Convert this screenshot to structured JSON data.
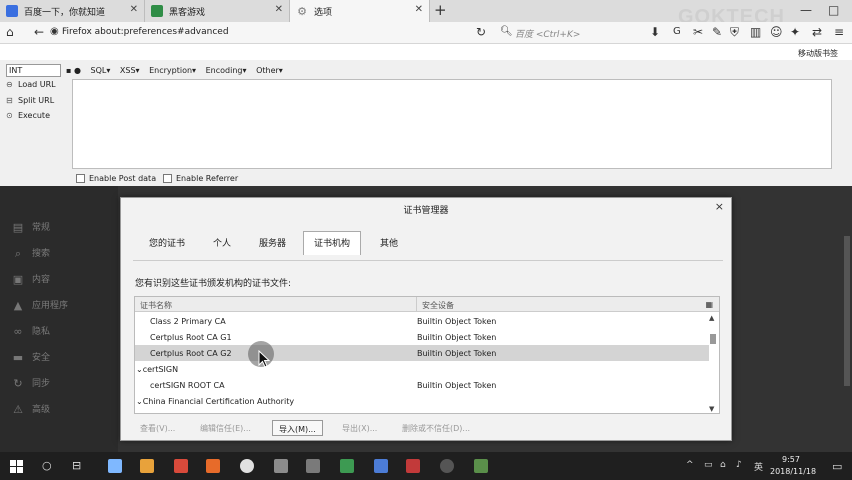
{
  "tabs": [
    {
      "title": "百度一下，你就知道",
      "color": "#3a6fe0"
    },
    {
      "title": "黑客游戏",
      "color": "#2f8d46"
    },
    {
      "title": "选项",
      "color": "#7a7a7a",
      "active": true
    }
  ],
  "new_tab": "+",
  "watermark": "GOKTECH",
  "window_controls": [
    "—",
    "□"
  ],
  "navbar": {
    "url": "Firefox   about:preferences#advanced",
    "search_placeholder": "百度 <Ctrl+K>",
    "mobile_bookmarks": "移动版书签"
  },
  "hackbar": {
    "select_value": "INT",
    "menu": [
      "SQL▾",
      "XSS▾",
      "Encryption▾",
      "Encoding▾",
      "Other▾"
    ],
    "actions": [
      "Load URL",
      "Split URL",
      "Execute"
    ],
    "checks": [
      "Enable Post data",
      "Enable Referrer"
    ]
  },
  "prefs_sidebar": [
    "常规",
    "搜索",
    "内容",
    "应用程序",
    "隐私",
    "安全",
    "同步",
    "高级"
  ],
  "dialog": {
    "title": "证书管理器",
    "close": "×",
    "tabs": [
      "您的证书",
      "个人",
      "服务器",
      "证书机构",
      "其他"
    ],
    "active_tab": "证书机构",
    "description": "您有识别这些证书颁发机构的证书文件:",
    "columns": [
      "证书名称",
      "安全设备"
    ],
    "rows": [
      {
        "name": "Class 2 Primary CA",
        "device": "Builtin Object Token",
        "indent": 2
      },
      {
        "name": "Certplus Root CA G1",
        "device": "Builtin Object Token",
        "indent": 2
      },
      {
        "name": "Certplus Root CA G2",
        "device": "Builtin Object Token",
        "indent": 2,
        "selected": true
      },
      {
        "name": "⌄certSIGN",
        "device": "",
        "indent": 0
      },
      {
        "name": "certSIGN ROOT CA",
        "device": "Builtin Object Token",
        "indent": 2
      },
      {
        "name": "⌄China Financial Certification Authority",
        "device": "",
        "indent": 0
      }
    ],
    "buttons": [
      "查看(V)...",
      "编辑信任(E)...",
      "导入(M)...",
      "导出(X)...",
      "删除或不信任(D)..."
    ]
  },
  "taskbar": {
    "icons": [
      "#7fb8ff",
      "#e8a23b",
      "#d94a3b",
      "#e76b2a",
      "#e0e0e0",
      "#8c8c8c",
      "#7a7a7a",
      "#3d9a52",
      "#4c7cd6",
      "#c23a3a",
      "#555555",
      "#5a8f4a"
    ],
    "tray": [
      "^",
      "▭",
      "♪",
      "英"
    ],
    "time": "9:57",
    "date": "2018/11/18"
  }
}
